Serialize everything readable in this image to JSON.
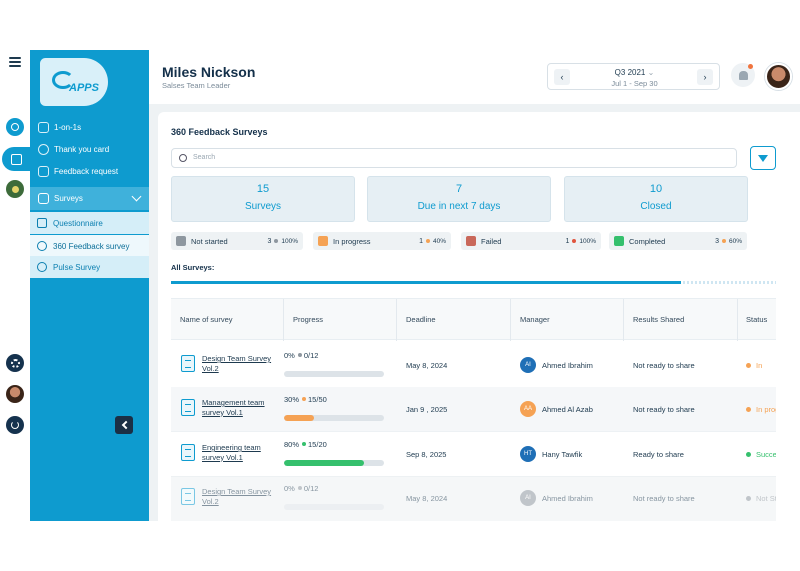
{
  "sidebar": {
    "logo_text": "APPS",
    "items": [
      {
        "label": "1-on-1s",
        "icon": "chat-icon"
      },
      {
        "label": "Thank you card",
        "icon": "badge-icon"
      },
      {
        "label": "Feedback request",
        "icon": "feedback-icon"
      }
    ],
    "group": {
      "label": "Surveys",
      "icon": "survey-icon"
    },
    "sub_items": [
      {
        "label": "Questionnaire",
        "icon": "questionnaire-icon"
      },
      {
        "label": "360 Feedback survey",
        "icon": "feedback-360-icon"
      },
      {
        "label": "Pulse Survey",
        "icon": "pulse-icon"
      }
    ]
  },
  "header": {
    "name": "Miles Nickson",
    "role": "Salses Team Leader",
    "quarter": "Q3 2021",
    "range": "Jul 1 - Sep 30"
  },
  "main": {
    "title": "360 Feedback Surveys",
    "search_placeholder": "Search",
    "stats": [
      {
        "value": "15",
        "label": "Surveys"
      },
      {
        "value": "7",
        "label": "Due in next 7 days"
      },
      {
        "value": "10",
        "label": "Closed"
      }
    ],
    "chips": [
      {
        "label": "Not started",
        "count": "3",
        "percent": "100%",
        "color": "#8e979f",
        "dot": "#8e979f"
      },
      {
        "label": "In progress",
        "count": "1",
        "percent": "40%",
        "color": "#f5a254",
        "dot": "#f5a254"
      },
      {
        "label": "Failed",
        "count": "1",
        "percent": "100%",
        "color": "#c9685a",
        "dot": "#e0553e"
      },
      {
        "label": "Completed",
        "count": "3",
        "percent": "60%",
        "color": "#35c06d",
        "dot": "#f5a254"
      }
    ],
    "all_label": "All Surveys:",
    "columns": [
      "Name of survey",
      "Progress",
      "Deadline",
      "Manager",
      "Results Shared",
      "Status"
    ],
    "rows": [
      {
        "name": "Design Team Survey Vol.2",
        "pct": "0%",
        "frac": "0/12",
        "progress": 0,
        "bar_color": "#c9d1d8",
        "dot": "#8e979f",
        "deadline": "May 8, 2024",
        "initials": "AI",
        "av_color": "#1f6fb6",
        "manager": "Ahmed Ibrahim",
        "results": "Not ready to share",
        "status": "In",
        "status_color": "#f5a254"
      },
      {
        "name": "Management team survey Vol.1",
        "pct": "30%",
        "frac": "15/50",
        "progress": 0.3,
        "bar_color": "#f5a254",
        "dot": "#f5a254",
        "deadline": "Jan 9 , 2025",
        "initials": "AA",
        "av_color": "#f5a254",
        "manager": "Ahmed Al Azab",
        "results": "Not ready to share",
        "status": "In progress",
        "status_color": "#f5a254"
      },
      {
        "name": "Engineering team survey Vol.1",
        "pct": "80%",
        "frac": "15/20",
        "progress": 0.8,
        "bar_color": "#35c06d",
        "dot": "#35c06d",
        "deadline": "Sep 8, 2025",
        "initials": "HT",
        "av_color": "#1f6fb6",
        "manager": "Hany Tawfik",
        "results": "Ready to share",
        "status": "Successful",
        "status_color": "#35c06d"
      },
      {
        "name": "Design Team Survey Vol.2",
        "pct": "0%",
        "frac": "0/12",
        "progress": 0,
        "bar_color": "#c9d1d8",
        "dot": "#8e979f",
        "deadline": "May 8, 2024",
        "initials": "AI",
        "av_color": "#8e979f",
        "manager": "Ahmed Ibrahim",
        "results": "Not ready to share",
        "status": "Not Started",
        "status_color": "#8e979f"
      }
    ]
  }
}
